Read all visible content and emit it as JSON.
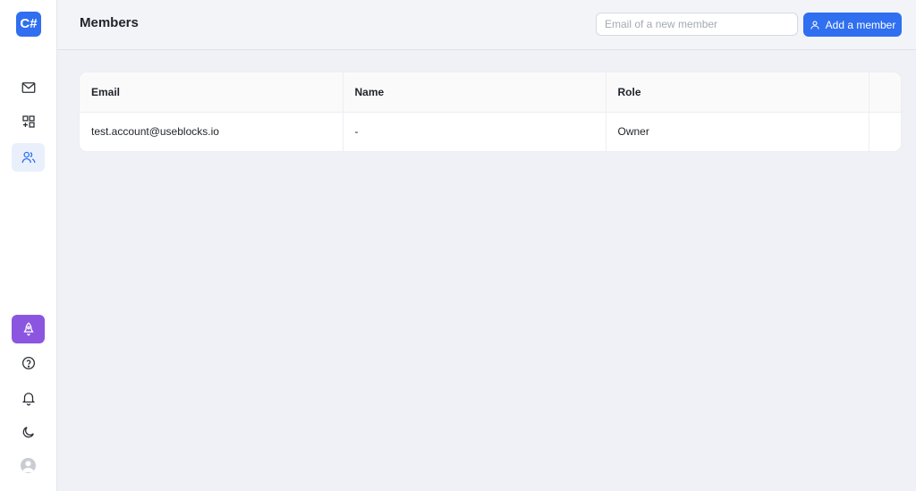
{
  "app": {
    "logo_text": "C#"
  },
  "header": {
    "title": "Members",
    "email_placeholder": "Email of a new member",
    "email_value": "",
    "add_button_label": "Add a member"
  },
  "sidebar": {
    "top_items": [
      {
        "name": "inbox",
        "icon": "mail-icon",
        "active": false
      },
      {
        "name": "apps",
        "icon": "apps-add-icon",
        "active": false
      },
      {
        "name": "members",
        "icon": "users-icon",
        "active": true
      }
    ],
    "bottom_items": [
      {
        "name": "launch",
        "icon": "rocket-icon",
        "accent": "#8b55e0"
      },
      {
        "name": "help",
        "icon": "help-circle-icon"
      },
      {
        "name": "notifications",
        "icon": "bell-icon"
      },
      {
        "name": "theme",
        "icon": "moon-icon"
      },
      {
        "name": "profile",
        "icon": "avatar"
      }
    ]
  },
  "table": {
    "columns": [
      "Email",
      "Name",
      "Role",
      ""
    ],
    "rows": [
      [
        "test.account@useblocks.io",
        "-",
        "Owner",
        ""
      ]
    ]
  },
  "colors": {
    "accent": "#2f6ff0",
    "launch": "#8b55e0",
    "background": "#f0f1f6"
  }
}
